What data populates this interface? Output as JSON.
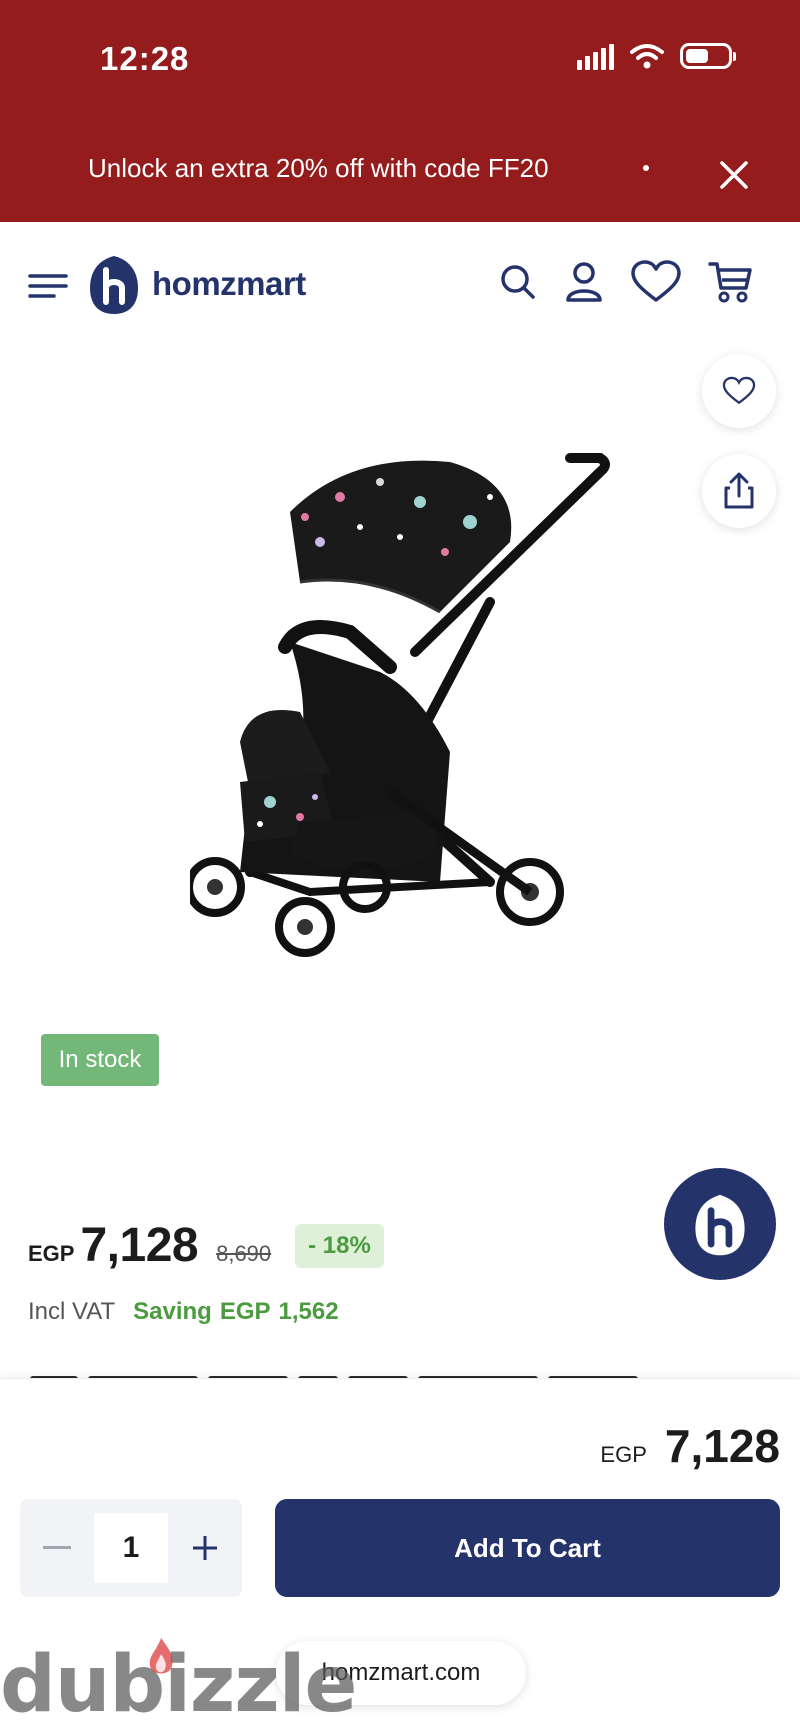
{
  "status_bar": {
    "time": "12:28"
  },
  "promo": {
    "text": "Unlock an extra 20% off with code FF20"
  },
  "header": {
    "brand": "homzmart"
  },
  "product": {
    "stock_badge": "In stock",
    "price_currency": "EGP",
    "price": "7,128",
    "old_price": "8,690",
    "discount": "- 18%",
    "vat_label": "Incl VAT",
    "saving_label": "Saving",
    "saving_currency": "EGP",
    "saving_amount": "1,562"
  },
  "cart_bar": {
    "total_currency": "EGP",
    "total": "7,128",
    "quantity": "1",
    "add_to_cart_label": "Add To Cart"
  },
  "browser": {
    "url": "homzmart.com"
  },
  "watermark": "dubizzle",
  "icons": {
    "menu": "menu-icon",
    "search": "search-icon",
    "account": "user-icon",
    "wishlist": "heart-icon",
    "cart": "cart-icon",
    "share": "share-icon",
    "close": "close-icon"
  },
  "colors": {
    "promo_bg": "#941c1c",
    "brand_navy": "#25336b",
    "stock_green": "#73b879",
    "saving_green": "#4a9c3e",
    "discount_bg": "#dff0d9"
  }
}
